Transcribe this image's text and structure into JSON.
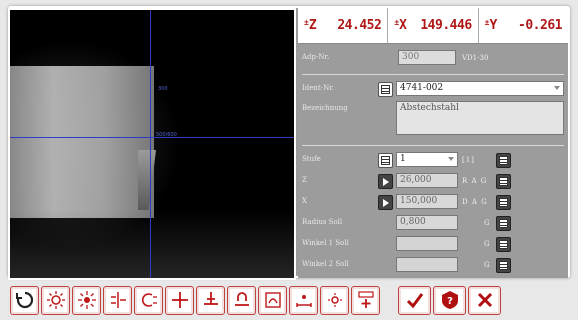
{
  "coords": [
    {
      "axis": "Z",
      "value": "24.452"
    },
    {
      "axis": "X",
      "value": "149.446"
    },
    {
      "axis": "Y",
      "value": "-0.261"
    }
  ],
  "camera": {
    "scale_top": "300",
    "scale_mid": "500/600"
  },
  "form": {
    "adp_label": "Adp-Nr.",
    "adp_value": "300",
    "adp_suffix": "VD1-30",
    "ident_label": "Ident-Nr.",
    "ident_value": "4741-002",
    "bez_label": "Bezeichnung",
    "bez_value": "Abstechstahl",
    "stufe_label": "Stufe",
    "stufe_value": "1",
    "stufe_suffix": "[1]",
    "z_label": "Z",
    "z_value": "26,000",
    "z_suffix": "R A G",
    "x_label": "X",
    "x_value": "150,000",
    "x_suffix": "D A G",
    "radius_label": "Radius Soll",
    "radius_value": "0,800",
    "radius_suffix": "G",
    "w1_label": "Winkel 1 Soll",
    "w1_suffix": "G",
    "w2_label": "Winkel 2 Soll",
    "w2_suffix": "G"
  },
  "toolbar": [
    "reset-icon",
    "light-ring-icon",
    "light-ring-2-icon",
    "center-adjust-icon",
    "circle-fit-icon",
    "crosshair-icon",
    "edge-line-icon",
    "magnet-icon",
    "tool-profile-icon",
    "zoom-move-icon",
    "light-small-icon",
    "table-add-icon",
    "check-icon",
    "help-icon",
    "close-icon"
  ],
  "colors": {
    "accent": "#c01818",
    "panel": "#9c9c9c"
  }
}
